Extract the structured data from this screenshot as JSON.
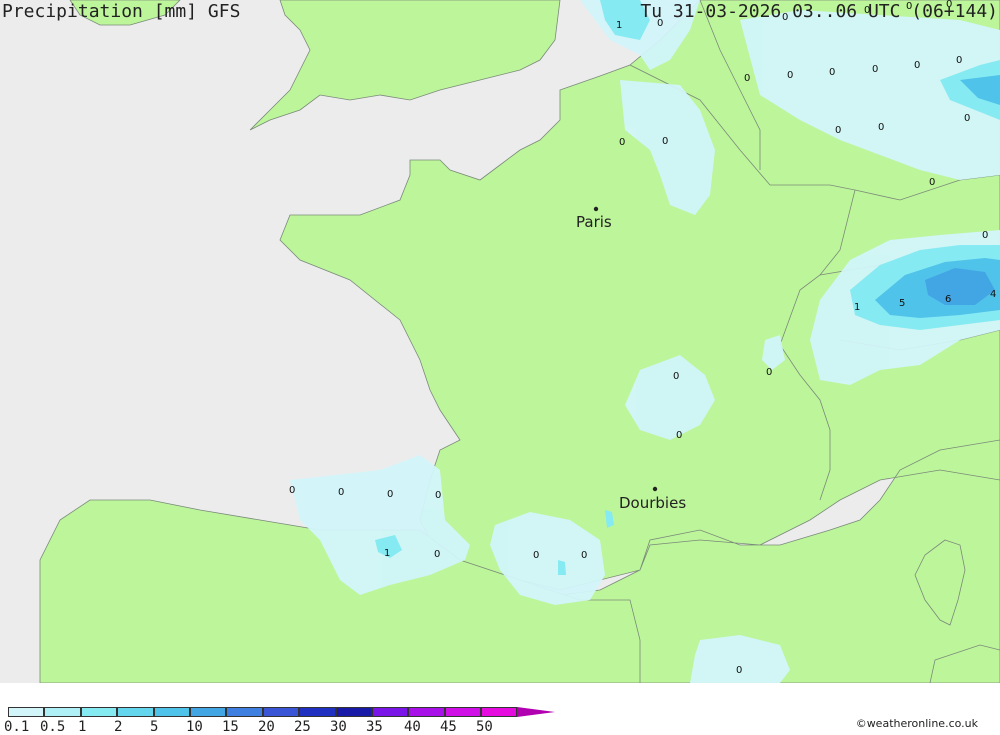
{
  "map": {
    "cities": [
      {
        "name": "Paris"
      },
      {
        "name": "Dourbies"
      }
    ],
    "precip_values": [
      "1",
      "0",
      "0",
      "0",
      "0",
      "0",
      "0",
      "0",
      "0",
      "0",
      "0",
      "0",
      "0",
      "0",
      "0",
      "0",
      "0",
      "0",
      "0",
      "1",
      "5",
      "6",
      "4",
      "0",
      "0",
      "0",
      "0",
      "0",
      "0",
      "0",
      "0",
      "1",
      "0",
      "0",
      "0",
      "0"
    ]
  },
  "footer": {
    "title": "Precipitation [mm] GFS",
    "time": "Tu 31-03-2026 03..06 UTC (06+144)",
    "credit": "©weatheronline.co.uk"
  },
  "legend": {
    "labels": [
      "0.1",
      "0.5",
      "1",
      "2",
      "5",
      "10",
      "15",
      "20",
      "25",
      "30",
      "35",
      "40",
      "45",
      "50"
    ],
    "colors": [
      "#d2f5fa",
      "#aef0f5",
      "#86eaf2",
      "#64d6ee",
      "#4fc3ea",
      "#43a6e4",
      "#3f7fe0",
      "#3a55d6",
      "#2030c0",
      "#1a1aa8",
      "#7a16e8",
      "#a812e8",
      "#d010e6",
      "#e60ce0"
    ]
  },
  "colors": {
    "land": "#bdf59a",
    "sea": "#ececec",
    "border": "#7a8a7a",
    "light_precip": "#d2f5fa",
    "medium_precip": "#86eaf2",
    "heavy_precip": "#4fc3ea",
    "heaviest_precip": "#43a6e4"
  }
}
